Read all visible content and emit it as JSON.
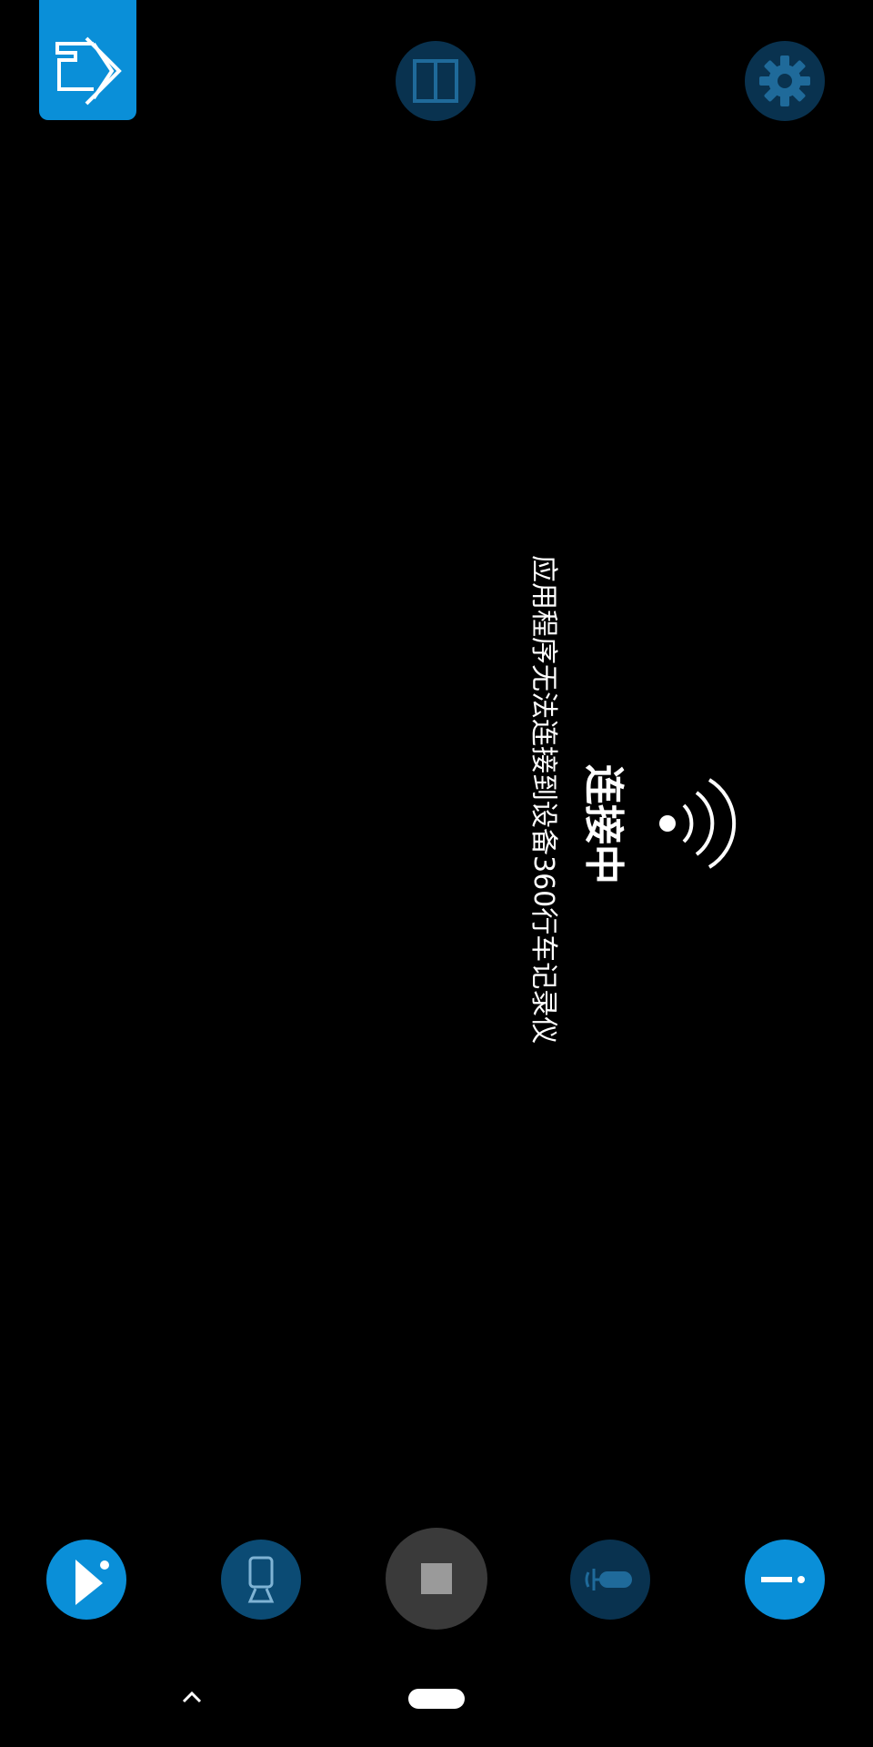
{
  "top_bar": {
    "exit_icon": "exit-arrow-icon",
    "split_icon": "split-view-icon",
    "settings_icon": "gear-icon"
  },
  "status": {
    "title": "连接中",
    "message": "应用程序无法连接到设备360行车记录仪",
    "icon": "wifi-signal-icon"
  },
  "bottom_bar": {
    "playback_icon": "play-icon",
    "camera_switch_icon": "camera-icon",
    "record_icon": "stop-icon",
    "mic_icon": "microphone-icon",
    "info_icon": "info-icon"
  },
  "colors": {
    "accent": "#0a8fd8",
    "dim_button": "#09324f",
    "background": "#000000"
  }
}
